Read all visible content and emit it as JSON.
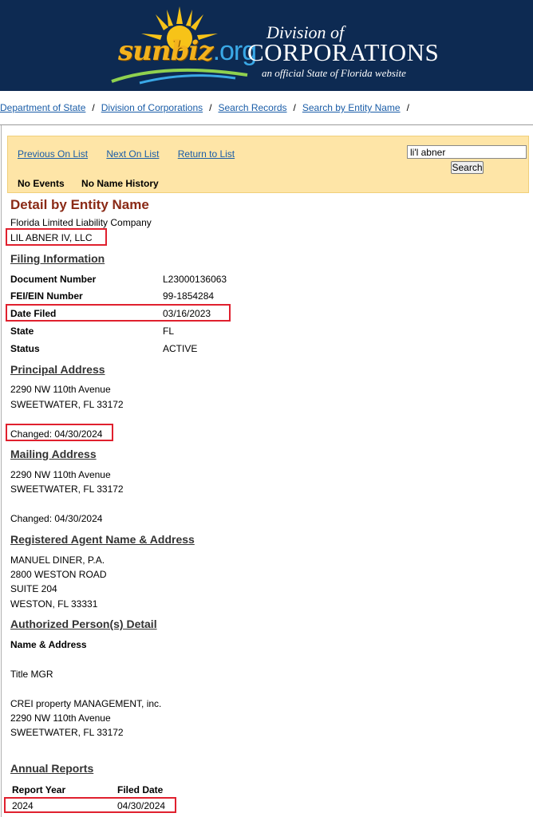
{
  "header": {
    "logo_main": "sunbiz",
    "logo_suffix": ".org",
    "division_of": "Division of",
    "corporations": "CORPORATIONS",
    "tagline": "an official State of Florida website"
  },
  "breadcrumb": [
    "Department of State",
    "Division of Corporations",
    "Search Records",
    "Search by Entity Name"
  ],
  "nav": {
    "previous": "Previous On List",
    "next": "Next On List",
    "return": "Return to List",
    "search_value": "li'l abner",
    "search_button": "Search",
    "no_events": "No Events",
    "no_name_history": "No Name History"
  },
  "detail": {
    "title": "Detail by Entity Name",
    "entity_type": "Florida Limited Liability Company",
    "entity_name": "LIL ABNER IV, LLC"
  },
  "filing": {
    "heading": "Filing Information",
    "rows": [
      {
        "label": "Document Number",
        "value": "L23000136063"
      },
      {
        "label": "FEI/EIN Number",
        "value": "99-1854284"
      },
      {
        "label": "Date Filed",
        "value": "03/16/2023"
      },
      {
        "label": "State",
        "value": "FL"
      },
      {
        "label": "Status",
        "value": "ACTIVE"
      }
    ]
  },
  "principal": {
    "heading": "Principal Address",
    "line1": "2290 NW 110th Avenue",
    "line2": "SWEETWATER, FL 33172",
    "changed": "Changed: 04/30/2024"
  },
  "mailing": {
    "heading": "Mailing Address",
    "line1": "2290 NW 110th Avenue",
    "line2": "SWEETWATER, FL 33172",
    "changed": "Changed: 04/30/2024"
  },
  "agent": {
    "heading": "Registered Agent Name & Address",
    "lines": [
      "MANUEL DINER, P.A.",
      "2800 WESTON ROAD",
      "SUITE 204",
      "WESTON, FL 33331"
    ]
  },
  "authorized": {
    "heading": "Authorized Person(s) Detail",
    "subheading": "Name & Address",
    "title": "Title MGR",
    "lines": [
      "CREI property MANAGEMENT, inc.",
      "2290 NW 110th Avenue",
      "SWEETWATER, FL 33172"
    ]
  },
  "annual": {
    "heading": "Annual Reports",
    "col_year": "Report Year",
    "col_date": "Filed Date",
    "rows": [
      {
        "year": "2024",
        "date": "04/30/2024"
      }
    ]
  },
  "colors": {
    "banner": "#0d2a52",
    "panel": "#fee5a7",
    "title": "#8a2a16",
    "link": "#1a5da8",
    "highlight": "#e0202e"
  }
}
